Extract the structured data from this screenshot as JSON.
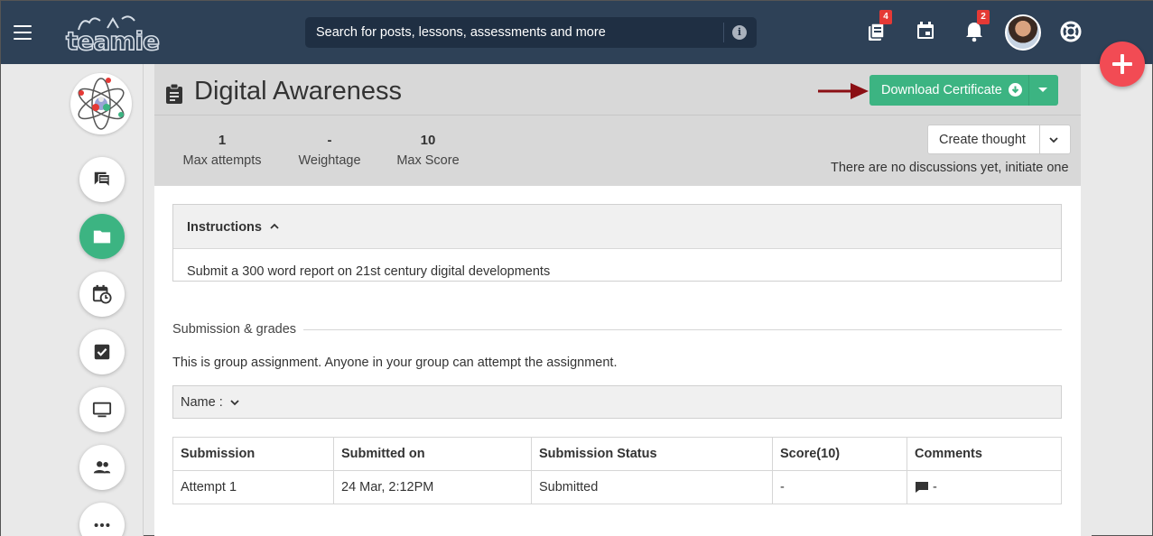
{
  "topbar": {
    "logo_text": "teamie",
    "search_placeholder": "Search for posts, lessons, assessments and more",
    "badges": {
      "posts_count": "4",
      "notifications_count": "2"
    }
  },
  "icons": {
    "menu": "hamburger-icon",
    "search_info": "info-icon",
    "posts": "posts-icon",
    "calendar": "calendar-icon",
    "notifications": "bell-icon",
    "help": "lifebuoy-icon",
    "fab": "plus-icon"
  },
  "leftnav": [
    {
      "name": "discussions",
      "icon": "chat-icon"
    },
    {
      "name": "materials",
      "icon": "folder-icon",
      "active": true
    },
    {
      "name": "schedule",
      "icon": "calendar-clock-icon"
    },
    {
      "name": "assessments",
      "icon": "checkbox-icon"
    },
    {
      "name": "classroom",
      "icon": "monitor-icon"
    },
    {
      "name": "members",
      "icon": "people-icon"
    },
    {
      "name": "more",
      "icon": "more-icon"
    }
  ],
  "assignment": {
    "title": "Digital Awareness",
    "download_label": "Download Certificate",
    "stats": [
      {
        "value": "1",
        "label": "Max attempts"
      },
      {
        "value": "-",
        "label": "Weightage"
      },
      {
        "value": "10",
        "label": "Max Score"
      }
    ],
    "create_thought_label": "Create thought",
    "no_discussions": "There are no discussions yet, initiate one"
  },
  "instructions": {
    "heading": "Instructions",
    "body": "Submit a 300 word report on 21st century digital developments"
  },
  "submissions": {
    "section_title": "Submission & grades",
    "group_note": "This is group assignment. Anyone in your group can attempt the assignment.",
    "name_filter_label": "Name :",
    "columns": [
      "Submission",
      "Submitted on",
      "Submission Status",
      "Score(10)",
      "Comments"
    ],
    "rows": [
      {
        "submission": "Attempt 1",
        "submitted_on": "24 Mar, 2:12PM",
        "status": "Submitted",
        "score": "-",
        "comments": "-"
      }
    ]
  },
  "colors": {
    "topbar": "#2e4157",
    "accent_green": "#3cb482",
    "fab_red": "#f24b54",
    "badge_red": "#e53935",
    "arrow_red": "#8b0f14"
  }
}
